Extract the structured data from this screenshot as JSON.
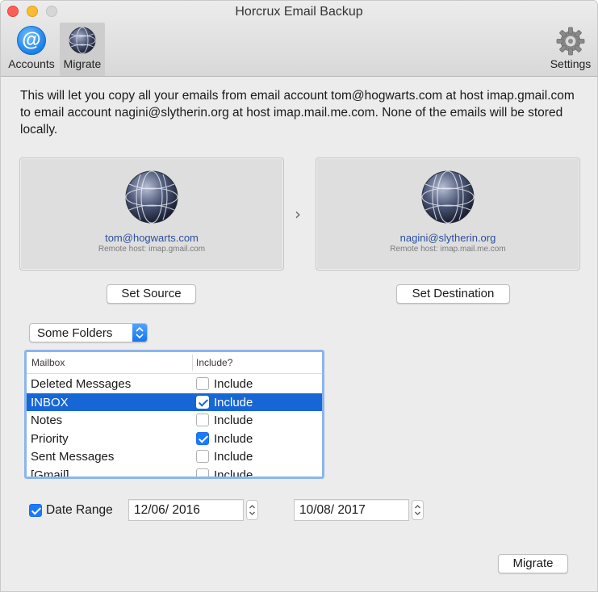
{
  "window": {
    "title": "Horcrux Email Backup"
  },
  "toolbar": {
    "accounts_label": "Accounts",
    "migrate_label": "Migrate",
    "settings_label": "Settings"
  },
  "description": "This will let you copy all your emails from email account tom@hogwarts.com at host imap.gmail.com to email account nagini@slytherin.org at host imap.mail.me.com. None of the emails will be stored locally.",
  "source": {
    "email": "tom@hogwarts.com",
    "host": "Remote host: imap.gmail.com",
    "button_label": "Set Source"
  },
  "destination": {
    "email": "nagini@slytherin.org",
    "host": "Remote host: imap.mail.me.com",
    "button_label": "Set Destination"
  },
  "folder_filter": {
    "selected": "Some Folders"
  },
  "mailbox_table": {
    "headers": [
      "Mailbox",
      "Include?"
    ],
    "rows": [
      {
        "mailbox": "Deleted Messages",
        "include": false,
        "label": "Include"
      },
      {
        "mailbox": "INBOX",
        "include": true,
        "label": "Include",
        "selected": true
      },
      {
        "mailbox": "Notes",
        "include": false,
        "label": "Include"
      },
      {
        "mailbox": "Priority",
        "include": true,
        "label": "Include"
      },
      {
        "mailbox": "Sent Messages",
        "include": false,
        "label": "Include"
      },
      {
        "mailbox": "[Gmail]",
        "include": false,
        "label": "Include"
      }
    ]
  },
  "date_range": {
    "enabled": true,
    "label": "Date Range",
    "start": "12/06/ 2016",
    "end": "10/08/ 2017"
  },
  "migrate_button_label": "Migrate",
  "colors": {
    "selection": "#1666d6",
    "checkbox_accent": "#1a7aff",
    "email_link": "#2a4f9e"
  }
}
